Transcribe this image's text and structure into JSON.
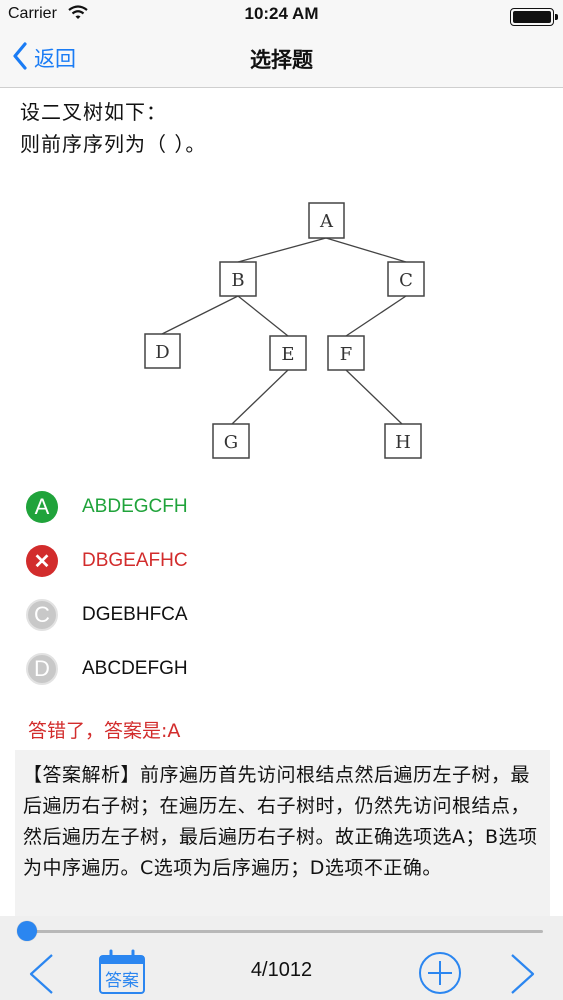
{
  "status_bar": {
    "carrier": "Carrier",
    "time": "10:24 AM"
  },
  "nav": {
    "back_label": "返回",
    "title": "选择题"
  },
  "question": {
    "line1": "设二叉树如下：",
    "line2": "则前序序列为（  ）。"
  },
  "tree": {
    "nodes": [
      "A",
      "B",
      "C",
      "D",
      "E",
      "F",
      "G",
      "H"
    ]
  },
  "options": [
    {
      "letter": "A",
      "text": "ABDEGCFH",
      "state": "correct"
    },
    {
      "letter": "✕",
      "text": "DBGEAFHC",
      "state": "wrong"
    },
    {
      "letter": "C",
      "text": "DGEBHFCA",
      "state": "neutral"
    },
    {
      "letter": "D",
      "text": "ABCDEFGH",
      "state": "neutral"
    }
  ],
  "result": {
    "text": "答错了，答案是:A"
  },
  "explanation": {
    "text": "【答案解析】前序遍历首先访问根结点然后遍历左子树，最后遍历右子树；在遍历左、右子树时，仍然先访问根结点，然后遍历左子树，最后遍历右子树。故正确选项选A；B选项为中序遍历。C选项为后序遍历；D选项不正确。"
  },
  "toolbar": {
    "answer_label": "答案",
    "page": "4/1012"
  },
  "progress": {
    "current": 4,
    "total": 1012
  },
  "colors": {
    "accent": "#1a7cf5",
    "correct": "#20a33b",
    "wrong": "#d22c2c",
    "neutral": "#c8c8c8"
  },
  "icons": {
    "back": "chevron-left-icon",
    "prev": "chevron-left-icon",
    "next": "chevron-right-icon",
    "add": "plus-circle-icon",
    "answer": "calendar-answer-icon",
    "wifi": "wifi-icon",
    "battery": "battery-icon"
  }
}
